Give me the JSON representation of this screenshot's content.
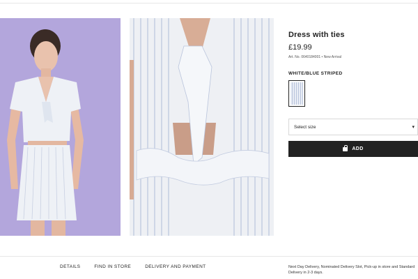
{
  "product": {
    "title": "Dress with ties",
    "price": "£19.99",
    "meta": "Art. No. 0640184001 • New Arrival",
    "color_label": "WHITE/BLUE STRIPED",
    "size_select_placeholder": "Select size",
    "add_label": "ADD"
  },
  "footer": {
    "tabs": [
      "DETAILS",
      "FIND IN STORE",
      "DELIVERY AND PAYMENT"
    ],
    "delivery_text": "Next Day Delivery, Nominated Delivery Slot, Pick-up in store and Standard Delivery in 2-3 days."
  },
  "colors": {
    "model_background": "#b3a6dc",
    "button": "#222222",
    "stripe": "#b9c4dc"
  },
  "icons": {
    "dropdown": "chevron-down-icon",
    "add_button": "shopping-bag-icon"
  }
}
